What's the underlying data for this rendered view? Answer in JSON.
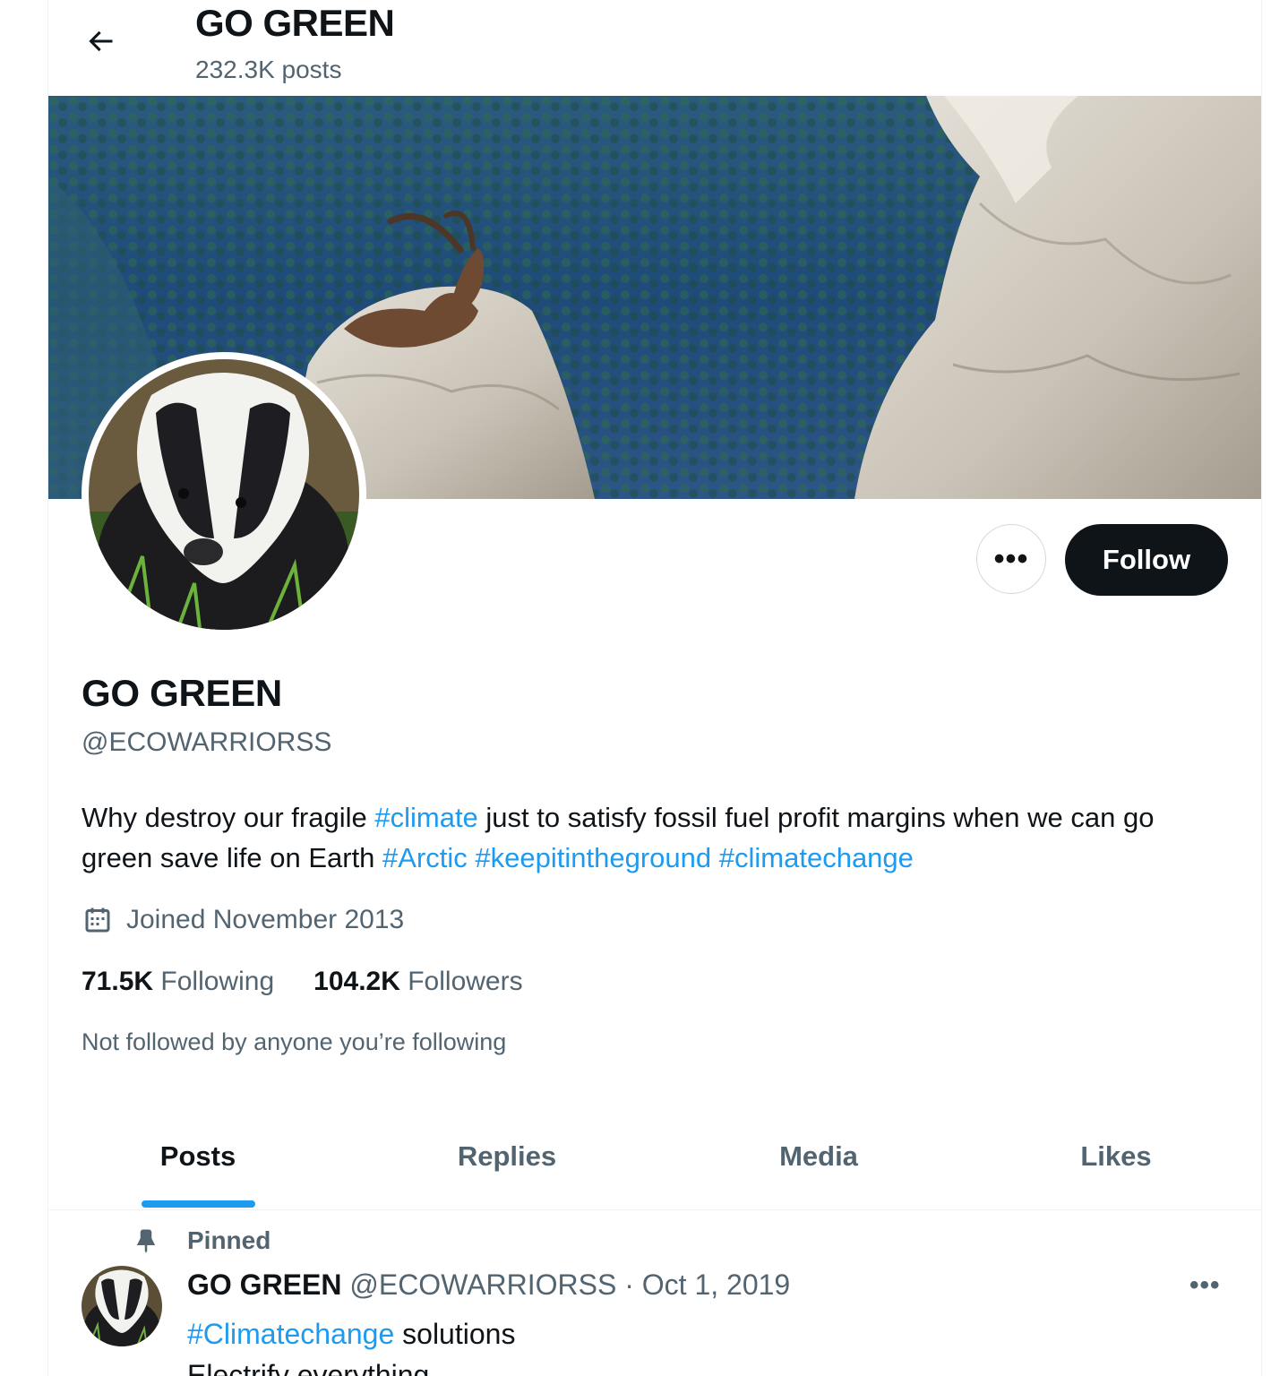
{
  "header": {
    "title": "GO GREEN",
    "posts_count": "232.3K posts"
  },
  "profile": {
    "display_name": "GO GREEN",
    "handle": "@ECOWARRIORSS",
    "bio": {
      "t1": "Why destroy our fragile ",
      "h1": "#climate",
      "t2": " just to satisfy fossil fuel profit margins when we can go green save life on Earth ",
      "h2": "#Arctic",
      "t3": " ",
      "h3": "#keepitintheground",
      "t4": " ",
      "h4": "#climatechange"
    },
    "joined": "Joined November 2013",
    "following_count": "71.5K",
    "following_label": "Following",
    "followers_count": "104.2K",
    "followers_label": "Followers",
    "not_followed": "Not followed by anyone you’re following"
  },
  "actions": {
    "more_label": "•••",
    "follow_label": "Follow"
  },
  "tabs": [
    {
      "label": "Posts",
      "active": true
    },
    {
      "label": "Replies",
      "active": false
    },
    {
      "label": "Media",
      "active": false
    },
    {
      "label": "Likes",
      "active": false
    }
  ],
  "pinned_post": {
    "pinned_label": "Pinned",
    "author_name": "GO GREEN",
    "author_handle": "@ECOWARRIORSS",
    "separator": " · ",
    "date": "Oct 1, 2019",
    "more_label": "•••",
    "hashtag": "#Climatechange",
    "text_after_hashtag": " solutions",
    "second_line": "Electrify everything"
  },
  "icons": {
    "back": "arrow-left-icon",
    "calendar": "calendar-icon",
    "pin": "pin-icon"
  },
  "colors": {
    "accent": "#1d9bf0",
    "text_primary": "#0f1419",
    "text_secondary": "#536471",
    "follow_bg": "#0f1419"
  }
}
